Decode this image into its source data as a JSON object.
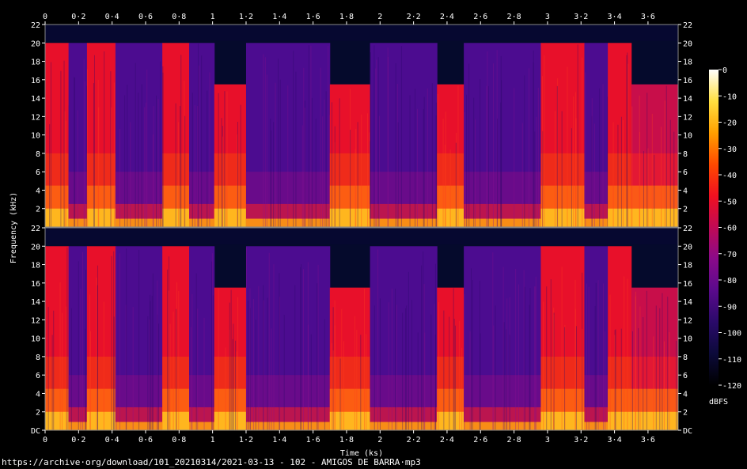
{
  "chart_data": {
    "type": "heatmap",
    "subtype": "spectrogram",
    "xlabel": "Time (ks)",
    "ylabel": "Frequency (kHz)",
    "x_ticks": [
      "0",
      "0·2",
      "0·4",
      "0·6",
      "0·8",
      "1",
      "1·2",
      "1·4",
      "1·6",
      "1·8",
      "2",
      "2·2",
      "2·4",
      "2·6",
      "2·8",
      "3",
      "3·2",
      "3·4",
      "3·6"
    ],
    "xlim": [
      0,
      3.78
    ],
    "channels": [
      {
        "name": "top",
        "y_ticks": [
          "22",
          "20",
          "18",
          "16",
          "14",
          "12",
          "10",
          "8",
          "6",
          "4",
          "2"
        ],
        "ylim": [
          0,
          22
        ]
      },
      {
        "name": "bottom",
        "y_ticks": [
          "22",
          "20",
          "18",
          "16",
          "14",
          "12",
          "10",
          "8",
          "6",
          "4",
          "2",
          "DC"
        ],
        "ylim": [
          0,
          22
        ]
      }
    ],
    "segments": [
      {
        "start": 0.0,
        "end": 0.14,
        "cutoff_khz": 20.0,
        "level": "loud"
      },
      {
        "start": 0.14,
        "end": 0.25,
        "cutoff_khz": 20.0,
        "level": "quiet"
      },
      {
        "start": 0.25,
        "end": 0.42,
        "cutoff_khz": 20.0,
        "level": "loud"
      },
      {
        "start": 0.42,
        "end": 0.7,
        "cutoff_khz": 20.0,
        "level": "quiet"
      },
      {
        "start": 0.7,
        "end": 0.86,
        "cutoff_khz": 20.0,
        "level": "loud"
      },
      {
        "start": 0.86,
        "end": 1.01,
        "cutoff_khz": 20.0,
        "level": "quiet"
      },
      {
        "start": 1.01,
        "end": 1.2,
        "cutoff_khz": 15.5,
        "level": "loud"
      },
      {
        "start": 1.2,
        "end": 1.7,
        "cutoff_khz": 20.0,
        "level": "quiet"
      },
      {
        "start": 1.7,
        "end": 1.94,
        "cutoff_khz": 15.5,
        "level": "loud"
      },
      {
        "start": 1.94,
        "end": 2.34,
        "cutoff_khz": 20.0,
        "level": "quiet"
      },
      {
        "start": 2.34,
        "end": 2.5,
        "cutoff_khz": 15.5,
        "level": "loud"
      },
      {
        "start": 2.5,
        "end": 2.96,
        "cutoff_khz": 20.0,
        "level": "quiet"
      },
      {
        "start": 2.96,
        "end": 3.22,
        "cutoff_khz": 20.0,
        "level": "loud"
      },
      {
        "start": 3.22,
        "end": 3.36,
        "cutoff_khz": 20.0,
        "level": "quiet"
      },
      {
        "start": 3.36,
        "end": 3.5,
        "cutoff_khz": 20.0,
        "level": "loud"
      },
      {
        "start": 3.5,
        "end": 3.78,
        "cutoff_khz": 15.5,
        "level": "mid"
      }
    ],
    "colorbar": {
      "label": "dBFS",
      "ticks": [
        "0",
        "-10",
        "-20",
        "-30",
        "-40",
        "-50",
        "-60",
        "-70",
        "-80",
        "-90",
        "-100",
        "-110",
        "-120"
      ],
      "range": [
        -120,
        0
      ],
      "colors": [
        "#000000",
        "#0c0a3a",
        "#2a0a6a",
        "#5a0a8c",
        "#8a0a8a",
        "#c00a55",
        "#f01020",
        "#ff4a00",
        "#ffa000",
        "#ffe040",
        "#ffffff"
      ]
    },
    "source": "https://archive·org/download/101_20210314/2021-03-13 - 102 - AMIGOS DE BARRA·mp3"
  }
}
